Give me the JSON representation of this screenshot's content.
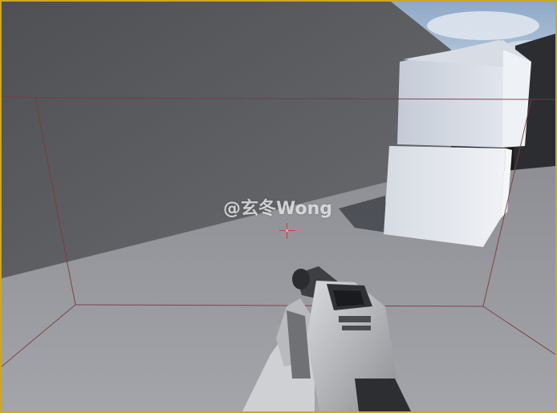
{
  "watermark": "@玄冬Wong",
  "colors": {
    "frame_border": "#c9a72a",
    "crosshair": "#d23a3a",
    "bounds_lines": "#7a3a3a",
    "sky": "#9fb6d0",
    "floor": "#9a9ba0",
    "wall": "#5f6064"
  },
  "icons": {
    "crosshair": "crosshair-icon"
  }
}
